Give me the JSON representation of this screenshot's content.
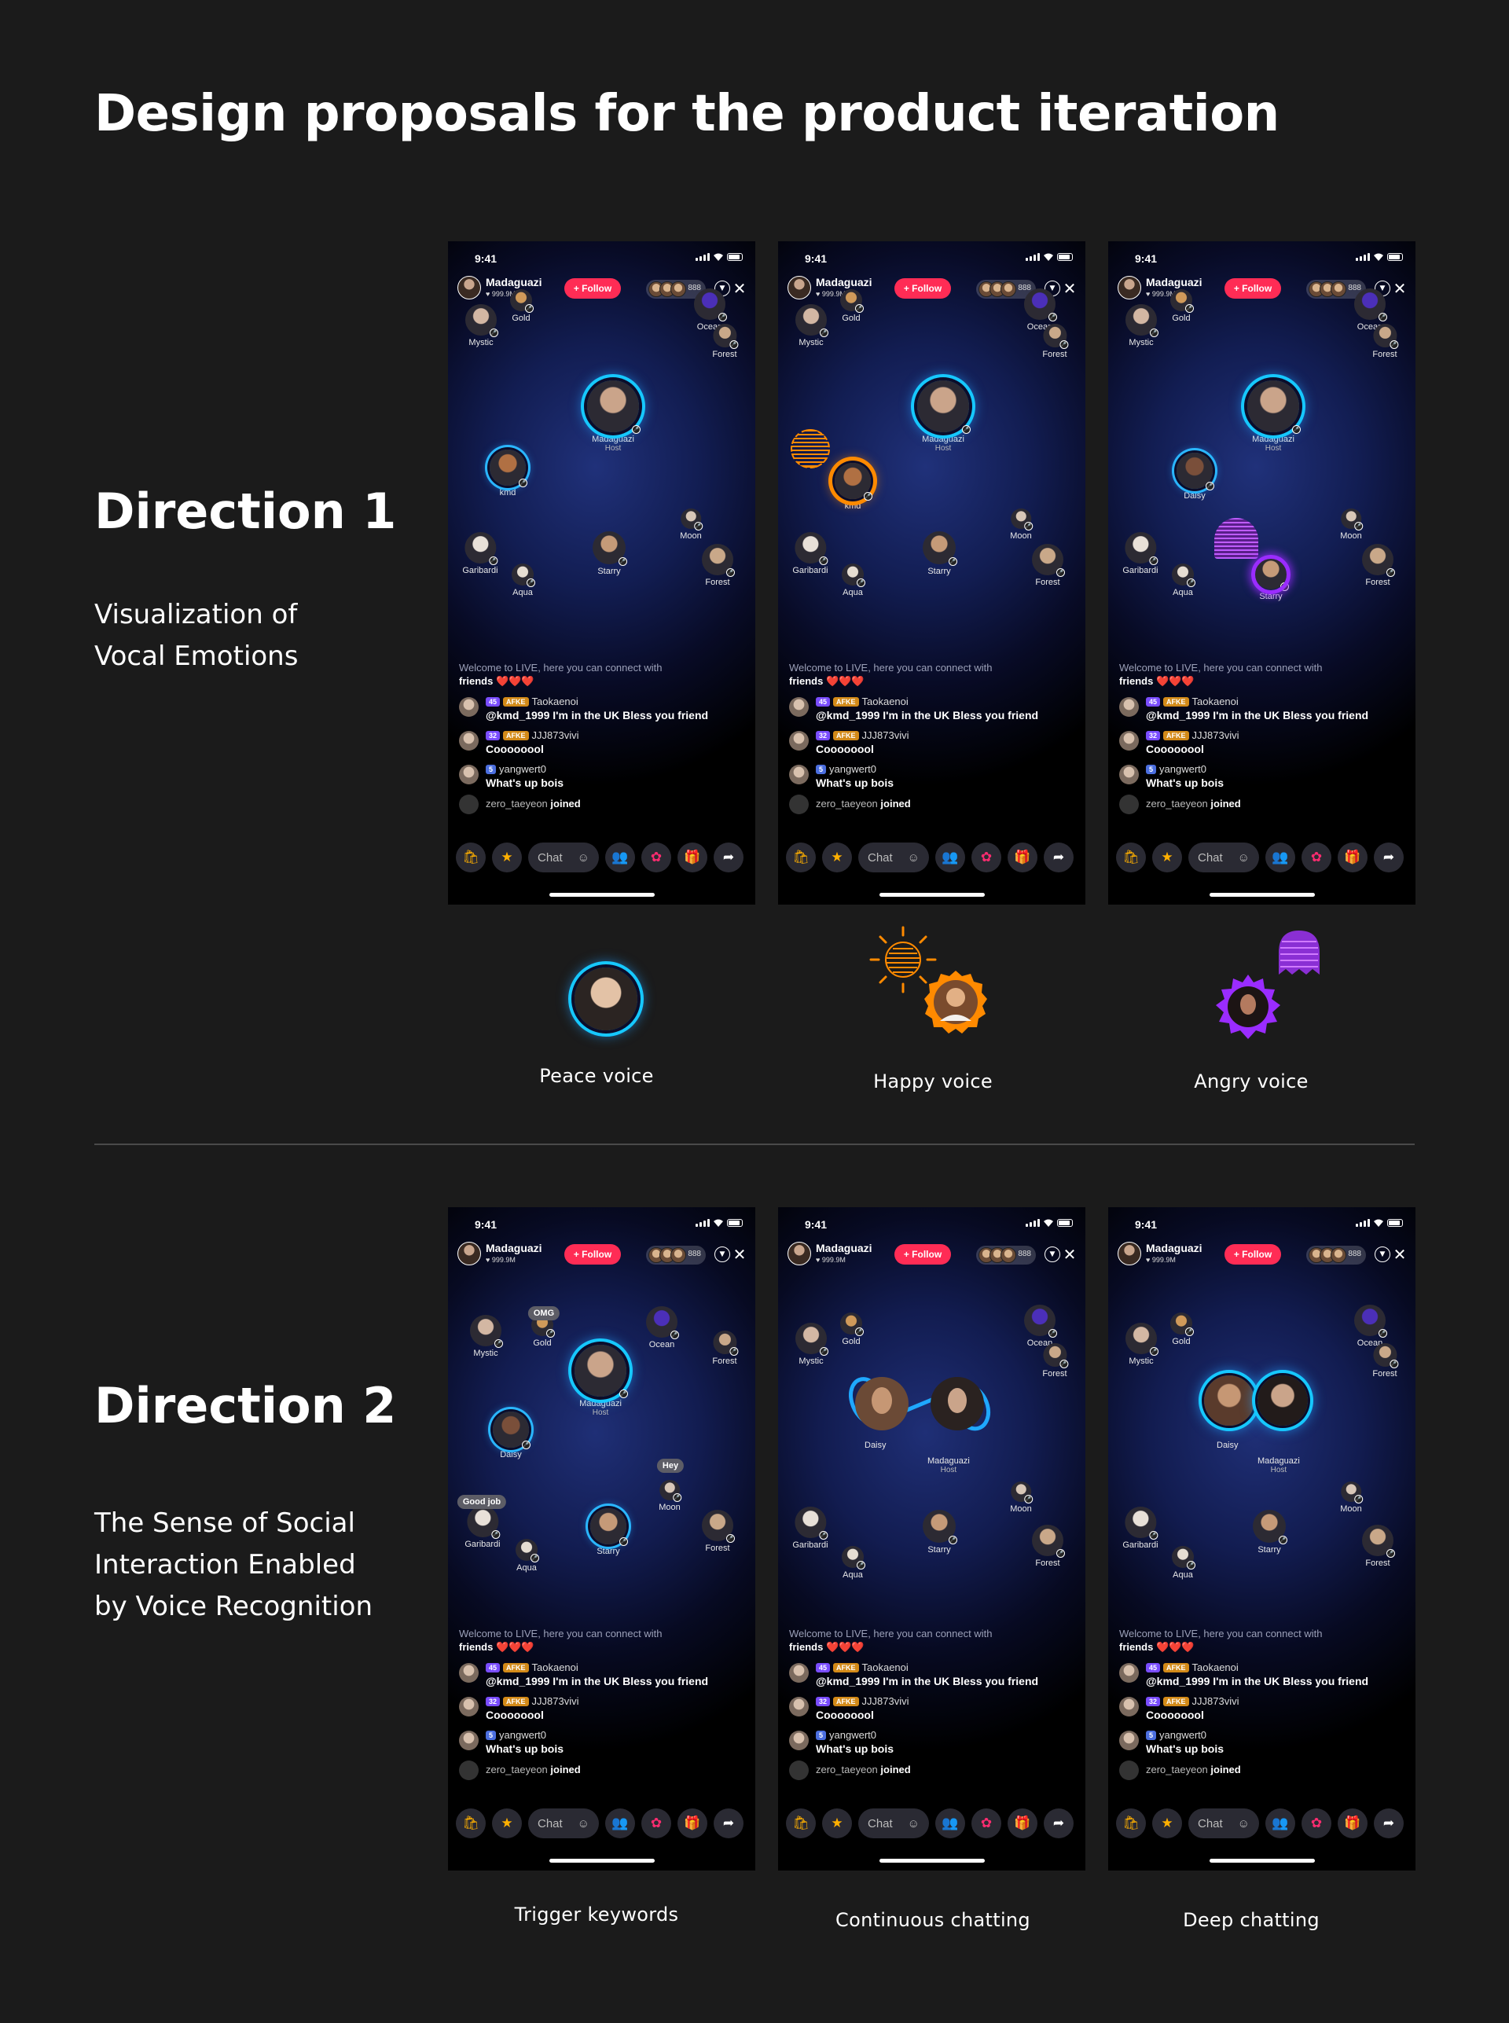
{
  "page": {
    "title": "Design proposals for the product iteration",
    "direction1": {
      "heading": "Direction 1",
      "description": "Visualization of Vocal Emotions"
    },
    "direction2": {
      "heading": "Direction 2",
      "description": "The Sense of Social Interaction Enabled by Voice Recognition"
    },
    "captions_row1": [
      "Peace voice",
      "Happy voice",
      "Angry voice"
    ],
    "captions_row2": [
      "Trigger keywords",
      "Continuous chatting",
      "Deep chatting"
    ]
  },
  "phone": {
    "time": "9:41",
    "host_name": "Madaguazi",
    "host_likes": "♥ 999.9M",
    "follow_label": "+ Follow",
    "viewer_count": "888",
    "chat_placeholder": "Chat",
    "welcome_text": "Welcome to LIVE, here you can connect with",
    "welcome_text2": "friends ❤️❤️❤️",
    "messages": [
      {
        "badge1": "45",
        "badge2": "AFKE",
        "user": "Taokaenoi",
        "text": "@kmd_1999 I'm in the UK Bless you friend"
      },
      {
        "badge1": "32",
        "badge2": "AFKE",
        "user": "JJJ873vivi",
        "text": "Coooooool"
      },
      {
        "badge1": "5",
        "user": "yangwert0",
        "text": "What's up bois"
      }
    ],
    "joined_user": "zero_taeyeon",
    "joined_label": "joined",
    "host_label": "Host"
  },
  "users": {
    "gold": "Gold",
    "ocean": "Ocean",
    "mystic": "Mystic",
    "forest": "Forest",
    "madaguazi": "Madaguazi",
    "kmd": "kmd",
    "daisy": "Daisy",
    "moon": "Moon",
    "garibardi": "Garibardi",
    "starry": "Starry",
    "aqua": "Aqua"
  },
  "bubbles": {
    "omg": "OMG",
    "hey": "Hey",
    "good_job": "Good job"
  },
  "colors": {
    "background": "#1b1b1b",
    "follow": "#ff2c55",
    "peace_ring": "#16c8ff",
    "happy": "#ff8a00",
    "angry": "#9a2cff"
  }
}
